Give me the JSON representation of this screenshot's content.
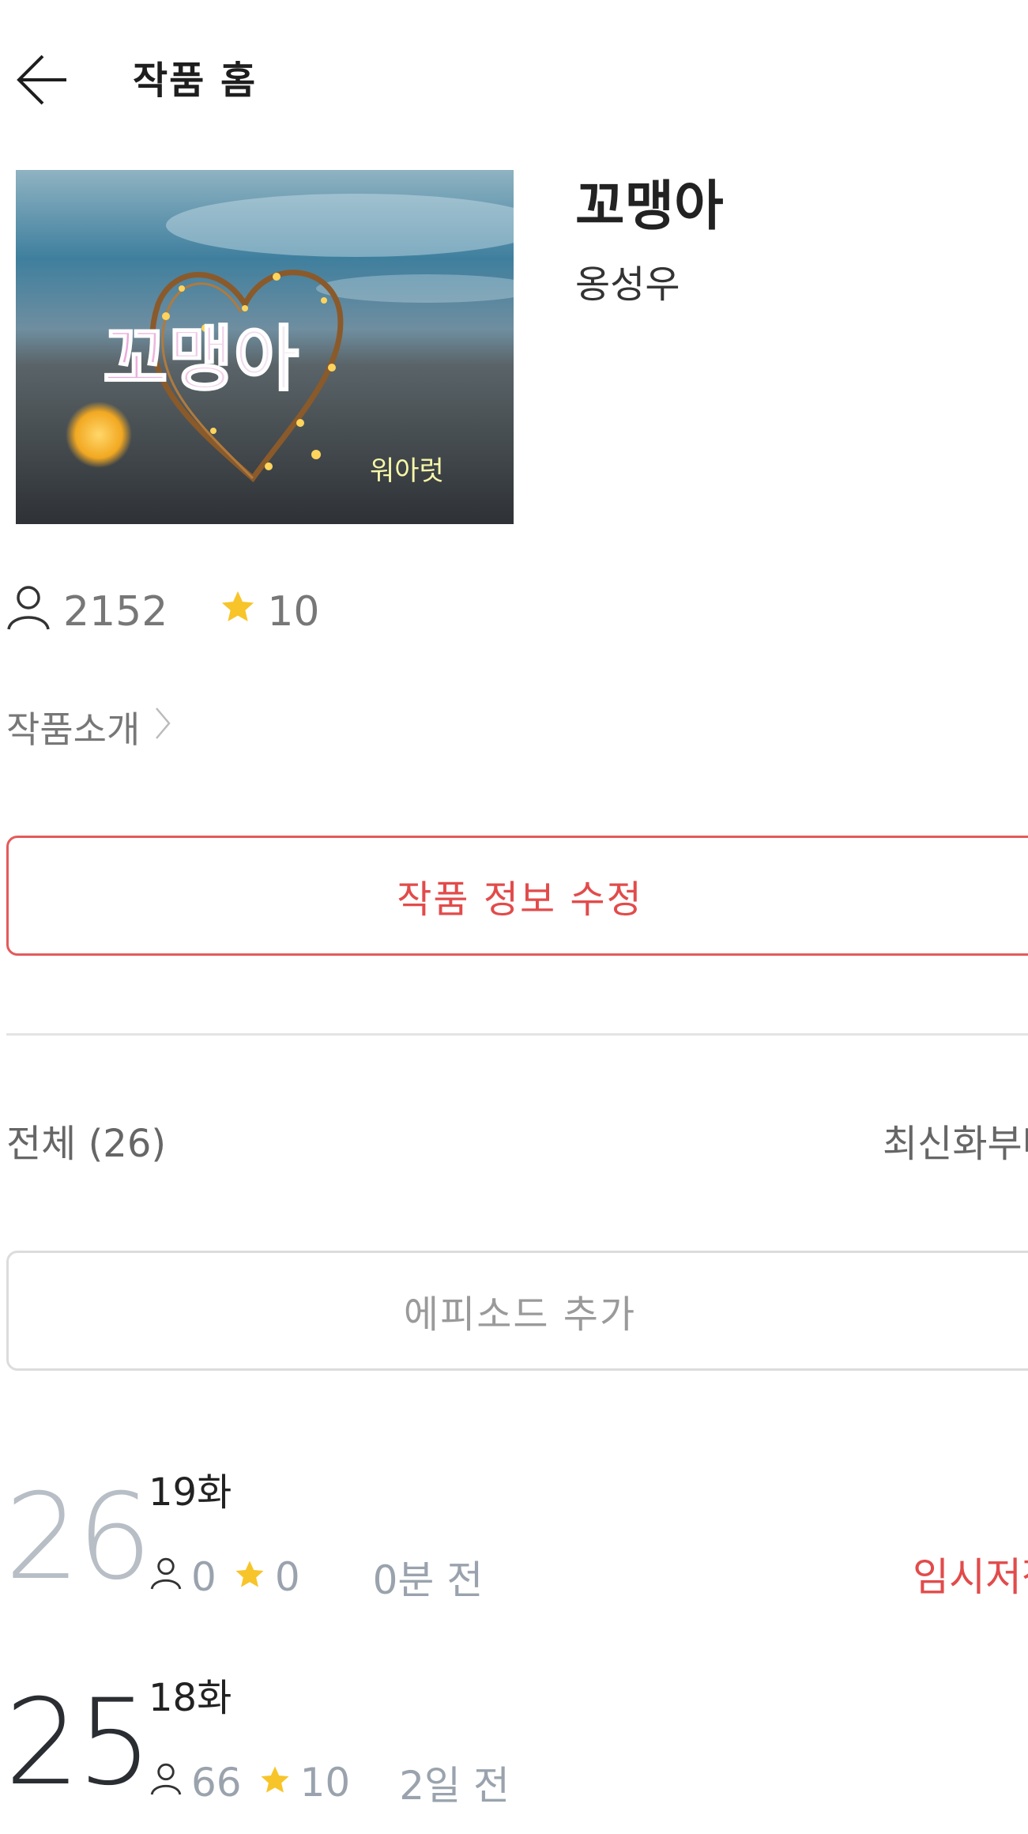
{
  "header": {
    "title": "작품 홈"
  },
  "work": {
    "title": "꼬맹아",
    "author": "옹성우",
    "cover_text": "꼬맹아",
    "cover_signature": "워아럿",
    "views": "2152",
    "rating": "10"
  },
  "intro_label": "작품소개",
  "edit_button_label": "작품 정보 수정",
  "list": {
    "all_label": "전체 (26)",
    "sort_label": "최신화부터",
    "add_episode_label": "에피소드 추가"
  },
  "episodes": [
    {
      "number": "26",
      "title": "19화",
      "views": "0",
      "rating": "0",
      "time": "0분 전",
      "status": "임시저장"
    },
    {
      "number": "25",
      "title": "18화",
      "views": "66",
      "rating": "10",
      "time": "2일 전",
      "status": ""
    }
  ],
  "colors": {
    "accent": "#e24b4b",
    "star": "#f7c52a",
    "muted_number": "#b8bec5"
  },
  "icons": [
    "back-arrow-icon",
    "person-icon",
    "star-icon",
    "chevron-right-icon"
  ]
}
